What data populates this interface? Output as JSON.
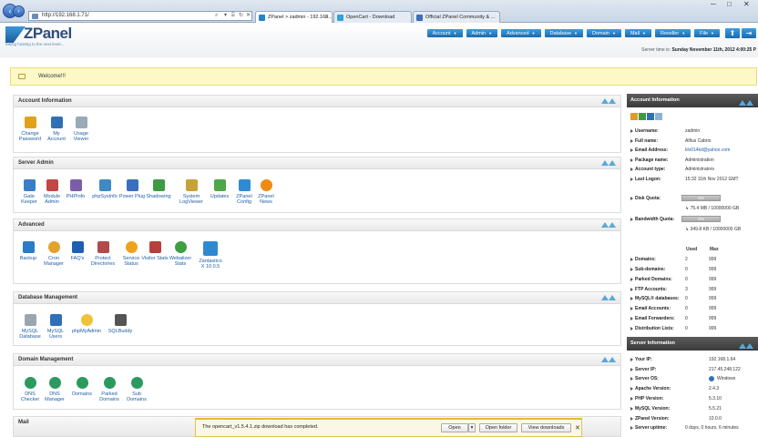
{
  "browser": {
    "url": "http://192.168.1.71/",
    "tabs": [
      {
        "label": "ZPanel > zadmin - 192.168...",
        "active": true
      },
      {
        "label": "OpenCart - Download",
        "active": false
      },
      {
        "label": "Official ZPanel Community & ...",
        "active": false
      }
    ],
    "window_controls": [
      "─",
      "□",
      "✕"
    ]
  },
  "header": {
    "logo": "ZPanel",
    "tagline": "taking hosting to the next level...",
    "nav": [
      {
        "label": "Account"
      },
      {
        "label": "Admin"
      },
      {
        "label": "Advanced"
      },
      {
        "label": "Database"
      },
      {
        "label": "Domain"
      },
      {
        "label": "Mail"
      },
      {
        "label": "Reseller"
      },
      {
        "label": "File"
      }
    ],
    "server_time_label": "Server time is:",
    "server_time": "Sunday November 11th, 2012 4:00:25 P"
  },
  "welcome": "Welcome!!!",
  "sections": [
    {
      "title": "Account Information",
      "items": [
        {
          "label": "Change Password",
          "icon": "lock-icon",
          "color": "#e0a21a"
        },
        {
          "label": "My Account",
          "icon": "user-icon",
          "color": "#2f6fb6"
        },
        {
          "label": "Usage Viewer",
          "icon": "chart-icon",
          "color": "#9aaab6"
        }
      ]
    },
    {
      "title": "Server Admin",
      "items": [
        {
          "label": "Gate Keeper",
          "icon": "gate-icon",
          "color": "#3a7ec8"
        },
        {
          "label": "Module Admin",
          "icon": "module-icon",
          "color": "#c24646"
        },
        {
          "label": "PHPInfo",
          "icon": "php-icon",
          "color": "#7c5ea8"
        },
        {
          "label": "phpSysInfo",
          "icon": "sysinfo-icon",
          "color": "#3d8ac6"
        },
        {
          "label": "Power Plug",
          "icon": "plug-icon",
          "color": "#3a6ec0"
        },
        {
          "label": "Shadowing",
          "icon": "users-icon",
          "color": "#3f9a44"
        },
        {
          "label": "System LogViewer",
          "icon": "log-icon",
          "color": "#c7a23a"
        },
        {
          "label": "Updates",
          "icon": "updates-icon",
          "color": "#4da64a"
        },
        {
          "label": "ZPanel Config",
          "icon": "config-icon",
          "color": "#2e8bd4"
        },
        {
          "label": "ZPanel News",
          "icon": "rss-icon",
          "color": "#f08a12"
        }
      ]
    },
    {
      "title": "Advanced",
      "items": [
        {
          "label": "Backup",
          "icon": "backup-icon",
          "color": "#2b7bc6"
        },
        {
          "label": "Cron Manager",
          "icon": "clock-icon",
          "color": "#e2a32a"
        },
        {
          "label": "FAQ's",
          "icon": "question-icon",
          "color": "#1e5fb6"
        },
        {
          "label": "Protect Directories",
          "icon": "protect-icon",
          "color": "#b34a4a"
        },
        {
          "label": "Service Status",
          "icon": "status-icon",
          "color": "#f0a21c"
        },
        {
          "label": "Visitor Stats",
          "icon": "visitor-icon",
          "color": "#b6403a"
        },
        {
          "label": "Webalizer Stats",
          "icon": "globe-icon",
          "color": "#3f9e3f"
        },
        {
          "label": "Zantastico X 10.0.5",
          "icon": "zantastico-icon",
          "color": "#2d8ad1"
        }
      ]
    },
    {
      "title": "Database Management",
      "items": [
        {
          "label": "MySQL Database",
          "icon": "database-icon",
          "color": "#9aa6ae"
        },
        {
          "label": "MySQL Users",
          "icon": "db-users-icon",
          "color": "#2f6fb6"
        },
        {
          "label": "phpMyAdmin",
          "icon": "phpmyadmin-icon",
          "color": "#f0c23a"
        },
        {
          "label": "SQLBuddy",
          "icon": "sqlbuddy-icon",
          "color": "#555555"
        }
      ]
    },
    {
      "title": "Domain Management",
      "items": [
        {
          "label": "DNS Checker",
          "icon": "dns-checker-icon",
          "color": "#2a9a5e"
        },
        {
          "label": "DNS Manager",
          "icon": "dns-manager-icon",
          "color": "#2a9a5e"
        },
        {
          "label": "Domains",
          "icon": "domains-icon",
          "color": "#2a9a5e"
        },
        {
          "label": "Parked Domains",
          "icon": "parked-icon",
          "color": "#2a9a5e"
        },
        {
          "label": "Sub Domains",
          "icon": "subdomains-icon",
          "color": "#2a9a5e"
        }
      ]
    },
    {
      "title": "Mail"
    }
  ],
  "account_info": {
    "title": "Account Information",
    "rows": [
      {
        "k": "Username:",
        "v": "zadmin"
      },
      {
        "k": "Full name:",
        "v": "Alfius Cabrio"
      },
      {
        "k": "Email Address:",
        "v": "klv014kd@yahoo.com"
      },
      {
        "k": "Package name:",
        "v": "Administration"
      },
      {
        "k": "Account type:",
        "v": "Administrators"
      },
      {
        "k": "Last Logon:",
        "v": "15:32 11th Nov 2012 GMT"
      }
    ],
    "disk_quota_label": "Disk Quota:",
    "disk_quota_bar": "0%",
    "disk_quota_text": "75.4 MB / 10000000 GB",
    "bandwidth_label": "Bandwidth Quota:",
    "bandwidth_bar": "0%",
    "bandwidth_text": "349.8 KB / 10000000 GB",
    "used_header": "Used",
    "max_header": "Max",
    "usage": [
      {
        "k": "Domains:",
        "used": "2",
        "max": "999"
      },
      {
        "k": "Sub-domains:",
        "used": "0",
        "max": "999"
      },
      {
        "k": "Parked Domains:",
        "used": "0",
        "max": "999"
      },
      {
        "k": "FTP Accounts:",
        "used": "3",
        "max": "999"
      },
      {
        "k": "MySQL® databases:",
        "used": "0",
        "max": "999"
      },
      {
        "k": "Email Accounts:",
        "used": "0",
        "max": "999"
      },
      {
        "k": "Email Forwarders:",
        "used": "0",
        "max": "999"
      },
      {
        "k": "Distribution Lists:",
        "used": "0",
        "max": "999"
      }
    ]
  },
  "server_info": {
    "title": "Server Information",
    "rows": [
      {
        "k": "Your IP:",
        "v": "192.168.1.64"
      },
      {
        "k": "Server IP:",
        "v": "217.45.248.122"
      },
      {
        "k": "Server OS:",
        "v": "Windows"
      },
      {
        "k": "Apache Version:",
        "v": "2.4.3"
      },
      {
        "k": "PHP Version:",
        "v": "5.3.10"
      },
      {
        "k": "MySQL Version:",
        "v": "5.5.21"
      },
      {
        "k": "ZPanel Version:",
        "v": "10.0.0"
      },
      {
        "k": "Server uptime:",
        "v": "0 days, 0 hours, 6 minutes"
      }
    ]
  },
  "download_bar": {
    "message": "The opencart_v1.5.4.1.zip download has completed.",
    "open": "Open",
    "open_folder": "Open folder",
    "view_downloads": "View downloads"
  }
}
